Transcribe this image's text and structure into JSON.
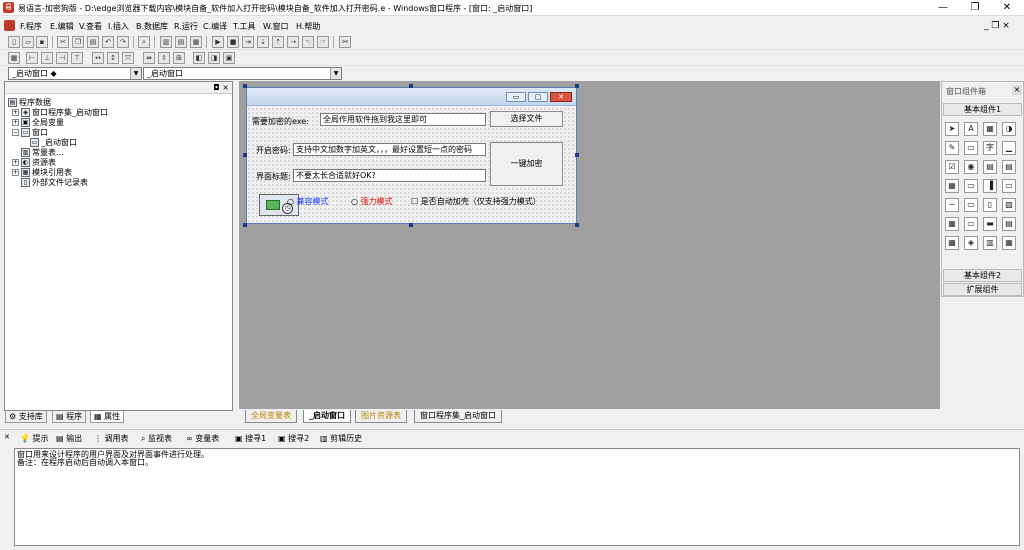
{
  "window": {
    "title": "易语言-加密狗版 - D:\\edge浏览器下载内容\\模块自备_软件加入打开密码\\模块自备_软件加入打开密码.e - Windows窗口程序 - [窗口: _启动窗口]",
    "minimize": "—",
    "restore": "❐",
    "close": "✕"
  },
  "menu": {
    "items": [
      "F.程序",
      "E.编辑",
      "V.查看",
      "I.插入",
      "B.数据库",
      "R.运行",
      "C.编译",
      "T.工具",
      "W.窗口",
      "H.帮助"
    ],
    "mdi_controls": "_ ❐ ×"
  },
  "combos": {
    "left": "_启动窗口 ◆",
    "right": "_启动窗口"
  },
  "left_panel": {
    "pin": "◘ ×",
    "tree": [
      {
        "label": "程序数据",
        "level": 0,
        "icon": "▤"
      },
      {
        "label": "窗口程序集_启动窗口",
        "level": 1,
        "icon": "◈",
        "plus": "+"
      },
      {
        "label": "全局变量",
        "level": 1,
        "icon": "▣",
        "plus": "+"
      },
      {
        "label": "窗口",
        "level": 1,
        "icon": "▭",
        "plus": "−"
      },
      {
        "label": "_启动窗口",
        "level": 2,
        "icon": "▭"
      },
      {
        "label": "常量表...",
        "level": 1,
        "icon": "▥"
      },
      {
        "label": "资源表",
        "level": 1,
        "icon": "◐",
        "plus": "+"
      },
      {
        "label": "模块引用表",
        "level": 1,
        "icon": "▦",
        "plus": "+"
      },
      {
        "label": "外部文件记录表",
        "level": 1,
        "icon": "▯"
      }
    ],
    "tabs": [
      "支持库",
      "程序",
      "属性"
    ]
  },
  "form": {
    "label1": "需要加密的exe:",
    "edit1": "全局作用软件拖到我这里即可",
    "btn_select": "选择文件",
    "label2": "开启密码:",
    "edit2": "支持中文加数字加英文，，，最好设置短一点的密码",
    "btn_encrypt": "一键加密",
    "label3": "界面标题:",
    "edit3": "不要太长合适就好OK?",
    "radio1": "兼容模式",
    "radio2": "强力模式",
    "checkbox": "是否自动加壳（仅支持强力模式）",
    "radio1_color": "#1a3cff",
    "radio2_color": "#e01010"
  },
  "toolbox": {
    "title": "窗口组件箱",
    "close": "×",
    "group1": "基本组件1",
    "group2": "基本组件2",
    "group3": "扩展组件",
    "tools": [
      "➤",
      "A",
      "▦",
      "◑",
      "✎",
      "▭",
      "字",
      "▁",
      "☑",
      "◉",
      "▤",
      "▤",
      "▦",
      "▭",
      "▐",
      "▭",
      "─",
      "▭",
      "▯",
      "▨",
      "▦",
      "▭",
      "▬",
      "▤",
      "▦",
      "◈",
      "▥",
      "▦"
    ]
  },
  "design_tabs": [
    "全局变量表",
    "_启动窗口",
    "图片资源表",
    "窗口程序集_启动窗口"
  ],
  "output": {
    "tabs": [
      "提示",
      "输出",
      "调用表",
      "监视表",
      "变量表",
      "搜寻1",
      "搜寻2",
      "剪辑历史"
    ],
    "lines": [
      "窗口用来设计程序的用户界面及对界面事件进行处理。",
      "备注：在程序启动后自动调入本窗口。"
    ]
  }
}
